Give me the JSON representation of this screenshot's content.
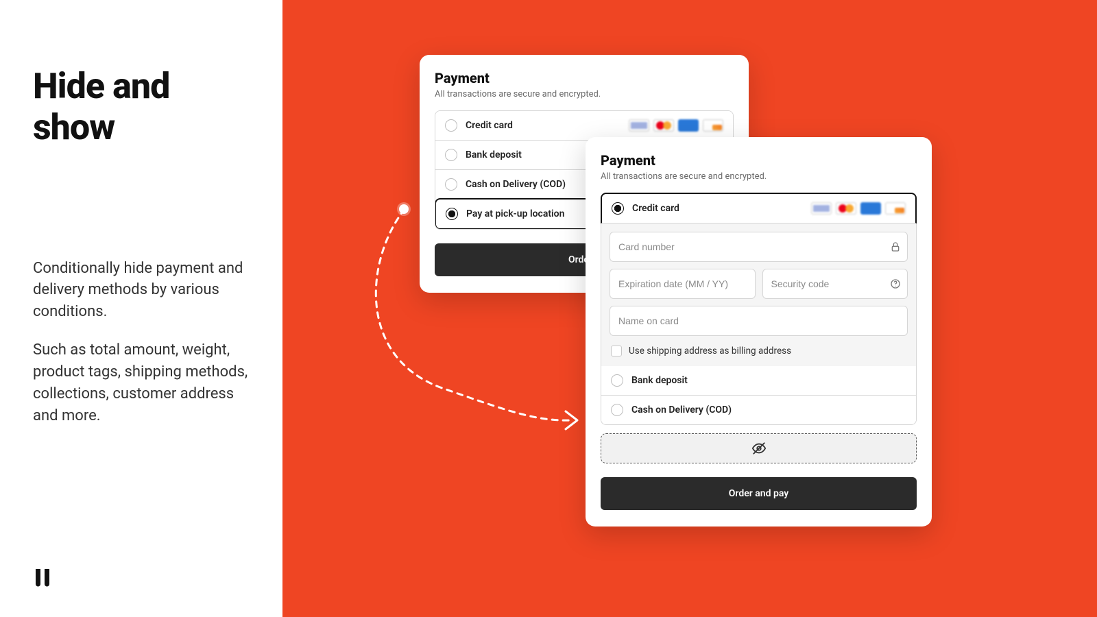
{
  "left": {
    "heading": "Hide and show",
    "para1": "Conditionally hide payment and delivery methods by various conditions.",
    "para2": "Such as total amount, weight, product tags, shipping methods, collections, customer address and more."
  },
  "card_a": {
    "title": "Payment",
    "subtitle": "All transactions are secure and encrypted.",
    "options": {
      "credit_card": "Credit card",
      "bank_deposit": "Bank deposit",
      "cod": "Cash on Delivery (COD)",
      "pickup": "Pay at pick-up location"
    },
    "button": "Order a"
  },
  "card_b": {
    "title": "Payment",
    "subtitle": "All transactions are secure and encrypted.",
    "options": {
      "credit_card": "Credit card",
      "bank_deposit": "Bank deposit",
      "cod": "Cash on Delivery (COD)"
    },
    "fields": {
      "card_number": "Card number",
      "expiration": "Expiration date (MM / YY)",
      "security": "Security code",
      "name": "Name on card"
    },
    "billing_check": "Use shipping address as billing address",
    "button": "Order and pay"
  }
}
